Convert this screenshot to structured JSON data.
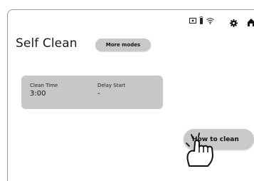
{
  "status_bar": {
    "icons": [
      "screen-share-icon",
      "remote-control-icon",
      "wifi-icon"
    ],
    "settings_icon": "gear-icon",
    "home_icon": "home-icon"
  },
  "page": {
    "title": "Self Clean",
    "more_modes_label": "More modes"
  },
  "info_card": {
    "clean_time_label": "Clean Time",
    "clean_time_value": "3:00",
    "delay_start_label": "Delay Start",
    "delay_start_value": "-"
  },
  "how_to_clean_label": "How to clean",
  "colors": {
    "card_bg": "#c7c7c7",
    "button_bg": "#c9c9c9",
    "text": "#1a1a1a"
  }
}
